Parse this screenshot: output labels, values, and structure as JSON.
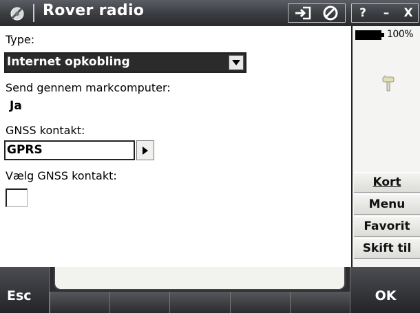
{
  "titlebar": {
    "title": "Rover radio",
    "help_label": "?",
    "minimize_label": "–",
    "close_label": "X"
  },
  "form": {
    "type_label": "Type:",
    "type_value": "Internet opkobling",
    "send_label": "Send gennem markcomputer:",
    "send_value": "Ja",
    "gnss_label": "GNSS kontakt:",
    "gnss_value": "GPRS",
    "select_gnss_label": "Vælg GNSS kontakt:",
    "select_gnss_checked": false
  },
  "status": {
    "battery_percent": "100%",
    "battery_level": 1.0
  },
  "softkeys": {
    "kort": "Kort",
    "menu": "Menu",
    "favorit": "Favorit",
    "skift_til": "Skift til"
  },
  "bottom": {
    "esc_label": "Esc",
    "ok_label": "OK"
  },
  "colors": {
    "titlebar": "#3a3c40",
    "content_bg": "#ffffff",
    "selected_bg": "#2b2b2b",
    "bottom_bar": "#2a2a2a"
  }
}
